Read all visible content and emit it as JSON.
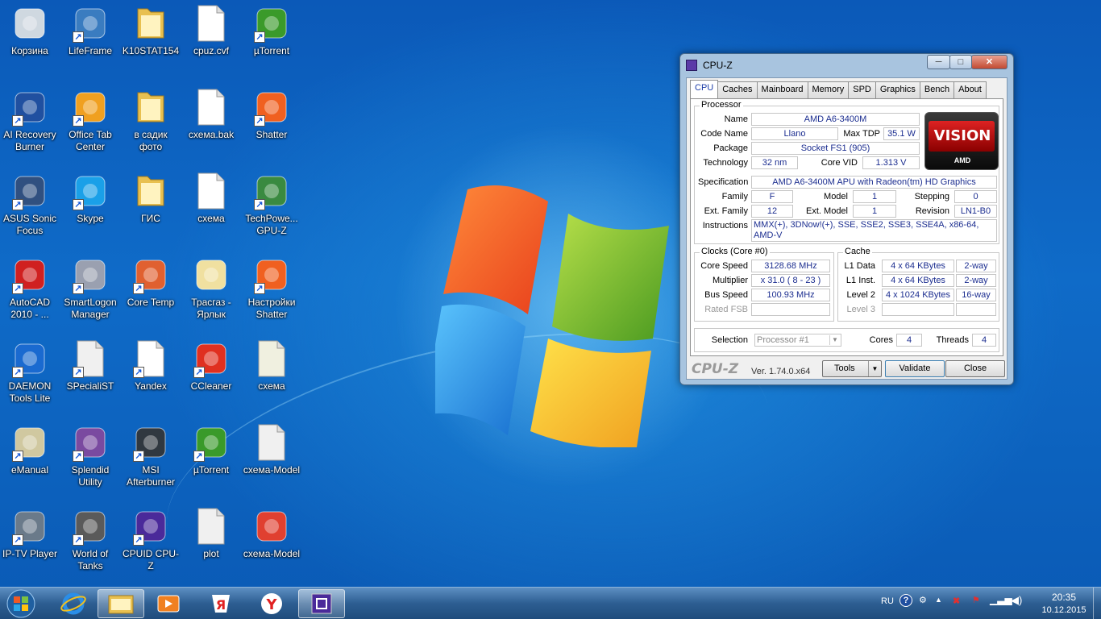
{
  "desktop": {
    "icons": [
      {
        "label": "Корзина"
      },
      {
        "label": "LifeFrame"
      },
      {
        "label": "K10STAT154"
      },
      {
        "label": "cpuz.cvf"
      },
      {
        "label": "µTorrent"
      },
      {
        "label": "AI Recovery Burner"
      },
      {
        "label": "Office Tab Center"
      },
      {
        "label": "в садик фото"
      },
      {
        "label": "схема.bak"
      },
      {
        "label": "Shatter"
      },
      {
        "label": "ASUS Sonic Focus"
      },
      {
        "label": "Skype"
      },
      {
        "label": "ГИС"
      },
      {
        "label": "схема"
      },
      {
        "label": "TechPowe... GPU-Z"
      },
      {
        "label": "AutoCAD 2010 - ..."
      },
      {
        "label": "SmartLogon Manager"
      },
      {
        "label": "Core Temp"
      },
      {
        "label": "Трасгаз - Ярлык"
      },
      {
        "label": "Настройки Shatter"
      },
      {
        "label": "DAEMON Tools Lite"
      },
      {
        "label": "SPecialiST"
      },
      {
        "label": "Yandex"
      },
      {
        "label": "CCleaner"
      },
      {
        "label": "схема"
      },
      {
        "label": "eManual"
      },
      {
        "label": "Splendid Utility"
      },
      {
        "label": "MSI Afterburner"
      },
      {
        "label": "µTorrent"
      },
      {
        "label": "схема-Model"
      },
      {
        "label": "IP-TV Player"
      },
      {
        "label": "World of Tanks"
      },
      {
        "label": "CPUID CPU-Z"
      },
      {
        "label": "plot"
      },
      {
        "label": "схема-Model"
      }
    ]
  },
  "cpuz": {
    "title": "CPU-Z",
    "min_glyph": "─",
    "max_glyph": "□",
    "close_glyph": "✕",
    "tabs": [
      "CPU",
      "Caches",
      "Mainboard",
      "Memory",
      "SPD",
      "Graphics",
      "Bench",
      "About"
    ],
    "processor": {
      "group": "Processor",
      "name_label": "Name",
      "name": "AMD A6-3400M",
      "codename_label": "Code Name",
      "codename": "Llano",
      "maxtdp_label": "Max TDP",
      "maxtdp": "35.1 W",
      "package_label": "Package",
      "package": "Socket FS1 (905)",
      "tech_label": "Technology",
      "tech": "32 nm",
      "corevid_label": "Core VID",
      "corevid": "1.313 V",
      "spec_label": "Specification",
      "spec": "AMD A6-3400M APU with Radeon(tm) HD Graphics",
      "family_label": "Family",
      "family": "F",
      "model_label": "Model",
      "model": "1",
      "stepping_label": "Stepping",
      "stepping": "0",
      "extfamily_label": "Ext. Family",
      "extfamily": "12",
      "extmodel_label": "Ext. Model",
      "extmodel": "1",
      "revision_label": "Revision",
      "revision": "LN1-B0",
      "instr_label": "Instructions",
      "instructions": "MMX(+), 3DNow!(+), SSE, SSE2, SSE3, SSE4A, x86-64, AMD-V",
      "logo_text": "VISION",
      "logo_sub": "AMD"
    },
    "clocks": {
      "group": "Clocks (Core #0)",
      "corespeed_label": "Core Speed",
      "corespeed": "3128.68 MHz",
      "mult_label": "Multiplier",
      "mult": "x 31.0 ( 8 - 23 )",
      "bus_label": "Bus Speed",
      "bus": "100.93 MHz",
      "fsb_label": "Rated FSB",
      "fsb": ""
    },
    "cache": {
      "group": "Cache",
      "l1d_label": "L1 Data",
      "l1d": "4 x 64 KBytes",
      "l1d_way": "2-way",
      "l1i_label": "L1 Inst.",
      "l1i": "4 x 64 KBytes",
      "l1i_way": "2-way",
      "l2_label": "Level 2",
      "l2": "4 x 1024 KBytes",
      "l2_way": "16-way",
      "l3_label": "Level 3",
      "l3": "",
      "l3_way": ""
    },
    "selection_label": "Selection",
    "selection": "Processor #1",
    "cores_label": "Cores",
    "cores": "4",
    "threads_label": "Threads",
    "threads": "4",
    "footer_brand": "CPU-Z",
    "version": "Ver. 1.74.0.x64",
    "tools": "Tools",
    "validate": "Validate",
    "close": "Close"
  },
  "taskbar": {
    "lang": "RU",
    "time": "20:35",
    "date": "10.12.2015"
  }
}
